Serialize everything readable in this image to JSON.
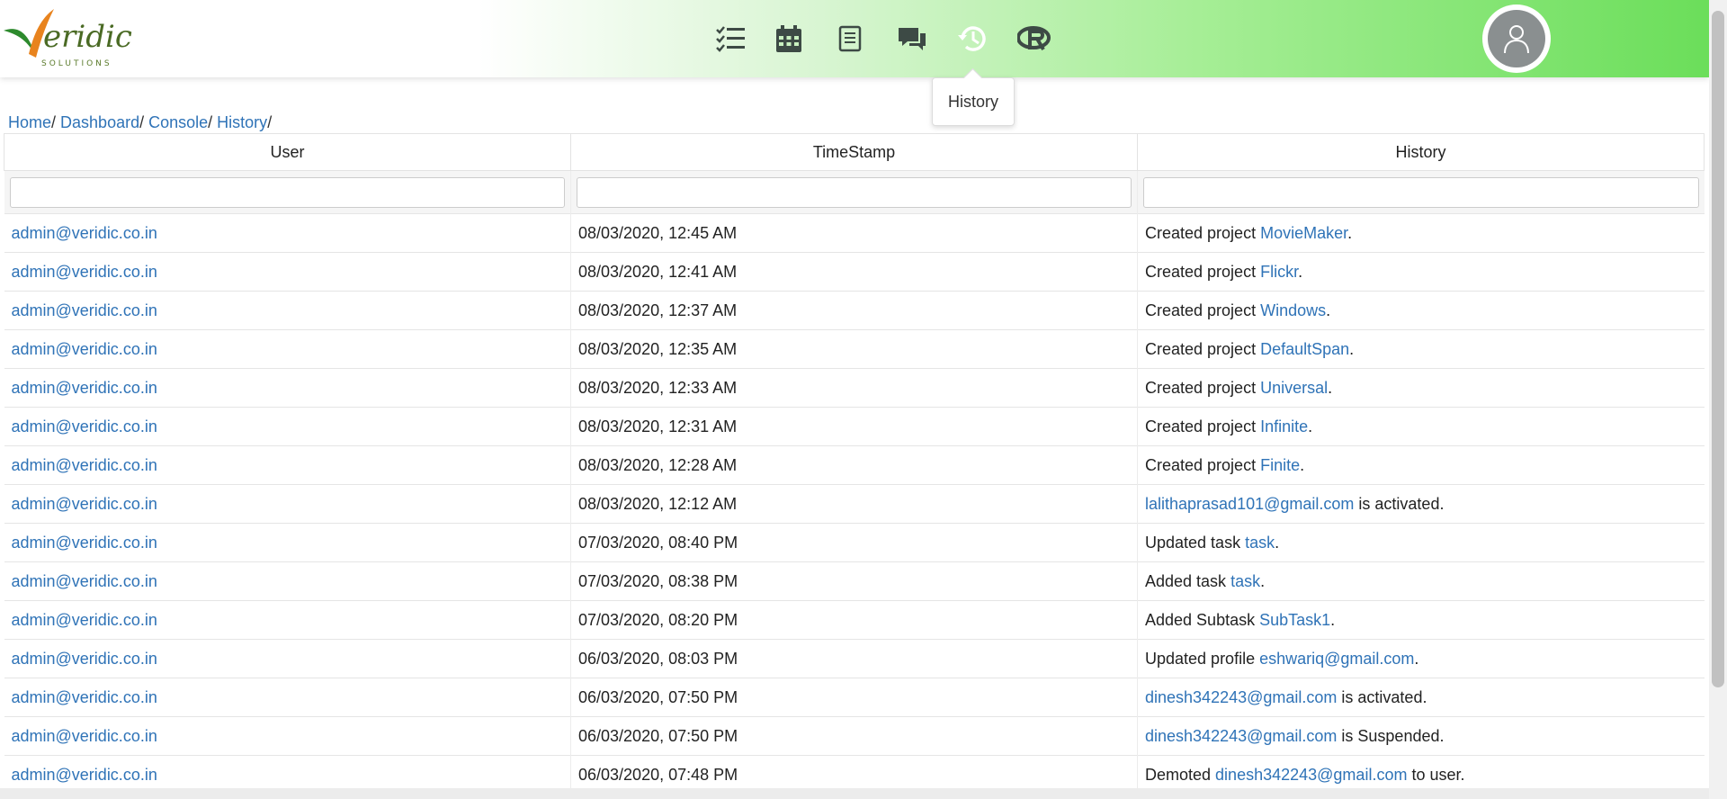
{
  "brand": {
    "name": "Veridic",
    "tagline": "SOLUTIONS"
  },
  "nav": [
    {
      "icon": "tasks-list-icon"
    },
    {
      "icon": "calendar-icon"
    },
    {
      "icon": "document-icon"
    },
    {
      "icon": "chat-icon"
    },
    {
      "icon": "history-icon",
      "active": true
    },
    {
      "icon": "r-logo-icon"
    }
  ],
  "tooltip": "History",
  "breadcrumb": {
    "home": "Home",
    "dashboard": "Dashboard",
    "console": "Console",
    "history": "History",
    "sep": "/ "
  },
  "table": {
    "headers": [
      "User",
      "TimeStamp",
      "History"
    ],
    "rows": [
      {
        "user": "admin@veridic.co.in",
        "time": "08/03/2020, 12:45 AM",
        "pre": "Created project ",
        "link": "MovieMaker",
        "post": "."
      },
      {
        "user": "admin@veridic.co.in",
        "time": "08/03/2020, 12:41 AM",
        "pre": "Created project ",
        "link": "Flickr",
        "post": "."
      },
      {
        "user": "admin@veridic.co.in",
        "time": "08/03/2020, 12:37 AM",
        "pre": "Created project ",
        "link": "Windows",
        "post": "."
      },
      {
        "user": "admin@veridic.co.in",
        "time": "08/03/2020, 12:35 AM",
        "pre": "Created project ",
        "link": "DefaultSpan",
        "post": "."
      },
      {
        "user": "admin@veridic.co.in",
        "time": "08/03/2020, 12:33 AM",
        "pre": "Created project ",
        "link": "Universal",
        "post": "."
      },
      {
        "user": "admin@veridic.co.in",
        "time": "08/03/2020, 12:31 AM",
        "pre": "Created project ",
        "link": "Infinite",
        "post": "."
      },
      {
        "user": "admin@veridic.co.in",
        "time": "08/03/2020, 12:28 AM",
        "pre": "Created project ",
        "link": "Finite",
        "post": "."
      },
      {
        "user": "admin@veridic.co.in",
        "time": "08/03/2020, 12:12 AM",
        "pre": "",
        "link": "lalithaprasad101@gmail.com",
        "post": " is activated."
      },
      {
        "user": "admin@veridic.co.in",
        "time": "07/03/2020, 08:40 PM",
        "pre": "Updated task ",
        "link": "task",
        "post": "."
      },
      {
        "user": "admin@veridic.co.in",
        "time": "07/03/2020, 08:38 PM",
        "pre": "Added task ",
        "link": "task",
        "post": "."
      },
      {
        "user": "admin@veridic.co.in",
        "time": "07/03/2020, 08:20 PM",
        "pre": "Added Subtask ",
        "link": "SubTask1",
        "post": "."
      },
      {
        "user": "admin@veridic.co.in",
        "time": "06/03/2020, 08:03 PM",
        "pre": "Updated profile ",
        "link": "eshwariq@gmail.com",
        "post": "."
      },
      {
        "user": "admin@veridic.co.in",
        "time": "06/03/2020, 07:50 PM",
        "pre": "",
        "link": "dinesh342243@gmail.com",
        "post": " is activated."
      },
      {
        "user": "admin@veridic.co.in",
        "time": "06/03/2020, 07:50 PM",
        "pre": "",
        "link": "dinesh342243@gmail.com",
        "post": " is Suspended."
      },
      {
        "user": "admin@veridic.co.in",
        "time": "06/03/2020, 07:48 PM",
        "pre": "Demoted ",
        "link": "dinesh342243@gmail.com",
        "post": " to user."
      }
    ]
  },
  "colors": {
    "link": "#2f73b7",
    "nav_icon": "#3d4a45",
    "nav_active": "#ffffff"
  }
}
